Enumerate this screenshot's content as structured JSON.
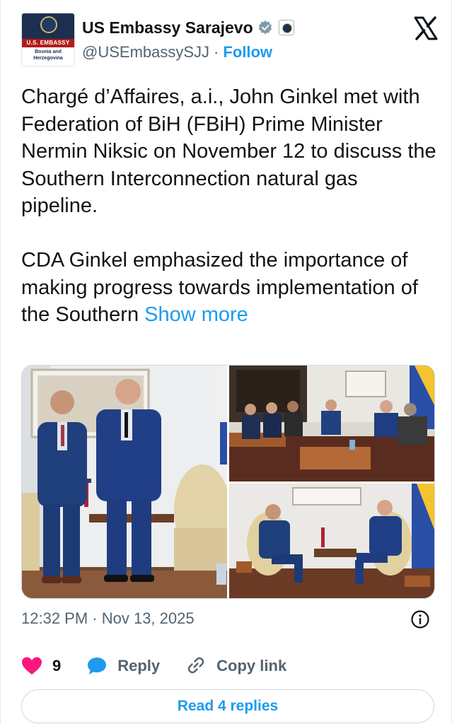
{
  "account": {
    "name": "US Embassy Sarajevo",
    "handle": "@USEmbassySJJ",
    "separator": "·",
    "follow_label": "Follow",
    "avatar_band_text": "U.S. EMBASSY",
    "avatar_sub_text": "Bosnia and Herzegovina"
  },
  "tweet": {
    "paragraph1": "Chargé d’Affaires, a.i., John Ginkel met with Federation of BiH (FBiH) Prime Minister Nermin Niksic on November 12 to discuss the Southern Interconnection natural gas pipeline.",
    "paragraph2": "CDA Ginkel emphasized the importance of making progress towards implementation of the Southern ",
    "show_more": "Show more"
  },
  "meta": {
    "timestamp": "12:32 PM · Nov 13, 2025"
  },
  "actions": {
    "like_count": "9",
    "reply_label": "Reply",
    "copy_label": "Copy link"
  },
  "footer": {
    "read_replies": "Read 4 replies"
  },
  "colors": {
    "accent": "#1d9bf0",
    "like": "#f91880",
    "text": "#0f1419",
    "muted": "#536471"
  },
  "icons": {
    "verified": "verified-badge-icon",
    "government": "government-affiliation-icon",
    "logo": "x-logo-icon",
    "info": "info-icon",
    "like": "heart-icon",
    "reply": "speech-bubble-icon",
    "copy": "link-icon"
  }
}
